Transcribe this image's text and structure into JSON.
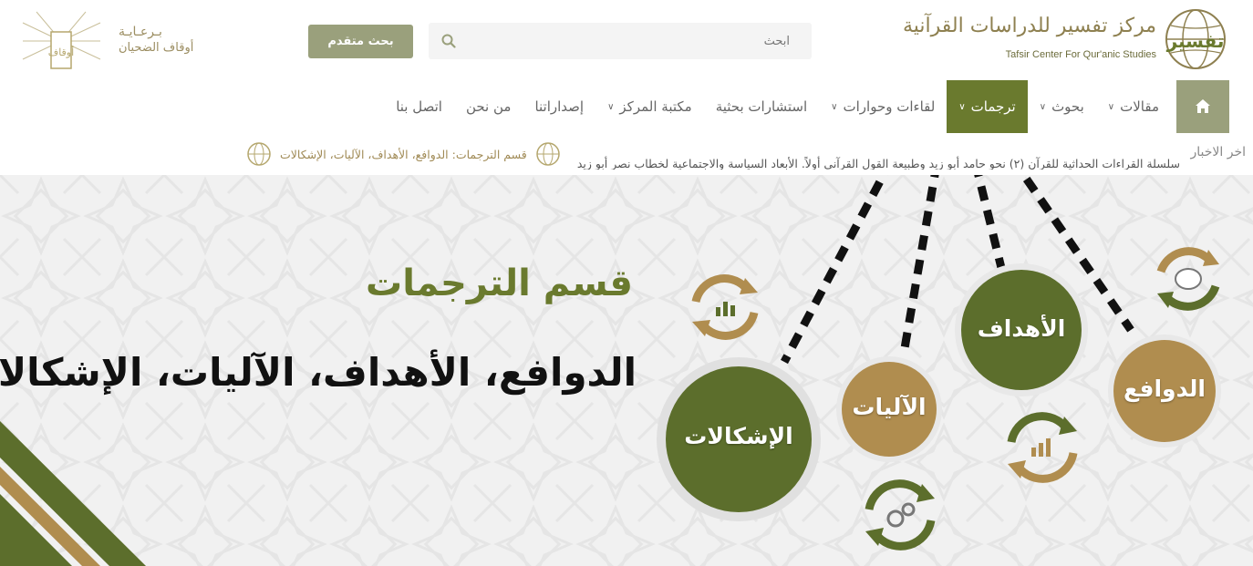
{
  "header": {
    "logo": {
      "title_ar": "مركز تفسير للدراسات القرآنية",
      "title_en": "Tafsir Center For Qur'anic Studies",
      "emblem_text": "تفسير"
    },
    "search": {
      "placeholder": "ابحث",
      "icon": "search-icon",
      "advanced_label": "بحث متقدم"
    },
    "sponsor": {
      "line1": "بـرعـايـة",
      "line2": "أوقاف الضحيان",
      "logo_text": "أوقاف الضحيان"
    }
  },
  "nav": {
    "home_icon": "home-icon",
    "items": [
      {
        "label": "مقالات",
        "dropdown": true,
        "active": false
      },
      {
        "label": "بحوث",
        "dropdown": true,
        "active": false
      },
      {
        "label": "ترجمات",
        "dropdown": true,
        "active": true
      },
      {
        "label": "لقاءات وحوارات",
        "dropdown": true,
        "active": false
      },
      {
        "label": "استشارات بحثية",
        "dropdown": false,
        "active": false
      },
      {
        "label": "مكتبة المركز",
        "dropdown": true,
        "active": false
      },
      {
        "label": "إصداراتنا",
        "dropdown": false,
        "active": false
      },
      {
        "label": "من نحن",
        "dropdown": false,
        "active": false
      },
      {
        "label": "اتصل بنا",
        "dropdown": false,
        "active": false
      }
    ]
  },
  "ticker": {
    "label": "اخر الاخبار",
    "items": [
      "سلسلة القراءات الحداثية للقرآن (٢) نحو حامد أبو زيد وطبيعة القول القرآني أولاً. الأبعاد السياسة والاجتماعية لخطاب نصر أبو زيد",
      "قسم الترجمات: الدوافع، الأهداف، الآليات، الإشكالات"
    ]
  },
  "hero": {
    "title": "قسم الترجمات",
    "subtitle": "الدوافع، الأهداف، الآليات، الإشكالات",
    "circles": [
      {
        "label": "الدوافع",
        "color": "#b08d4f"
      },
      {
        "label": "الأهداف",
        "color": "#5c6e2c"
      },
      {
        "label": "الآليات",
        "color": "#b08d4f"
      },
      {
        "label": "الإشكالات",
        "color": "#5c6e2c"
      }
    ],
    "icons": [
      "brain-cycle-icon",
      "growth-chart-cycle-icon",
      "gears-cycle-icon",
      "chart-cycle-icon"
    ]
  },
  "colors": {
    "brand_green": "#6a7a2e",
    "brand_gold": "#b08d4f",
    "button_olive": "#9aa07c"
  }
}
